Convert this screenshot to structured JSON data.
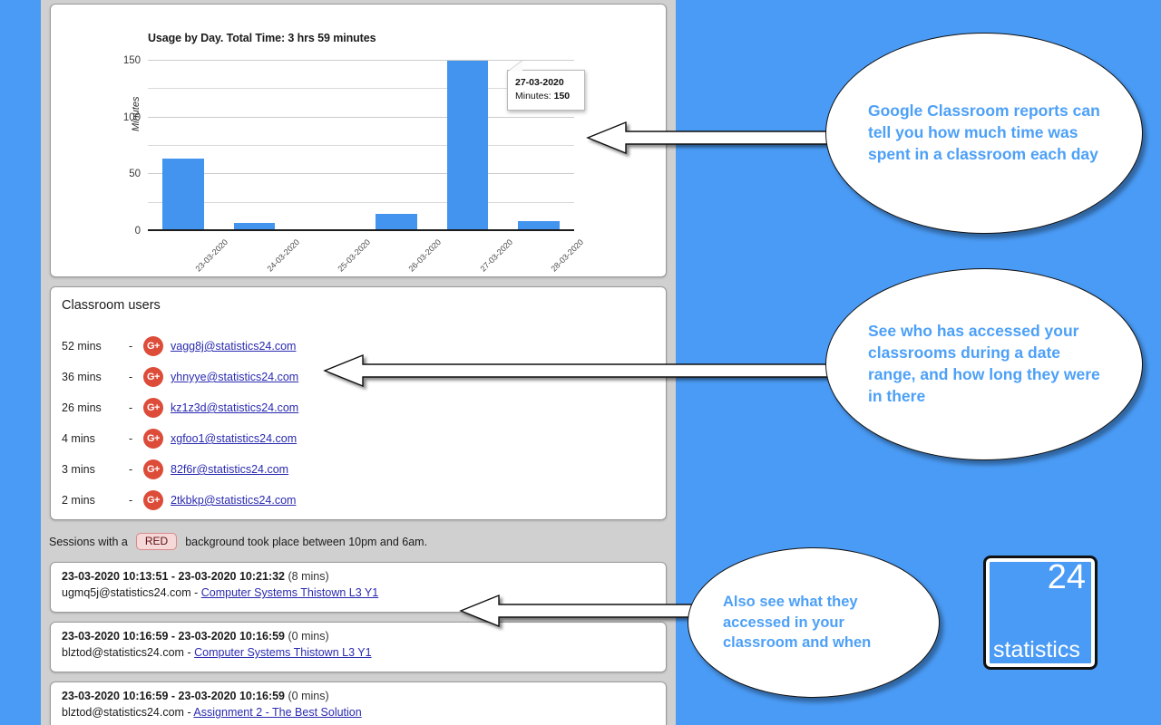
{
  "theme": {
    "background_blue": "#4a9bf5",
    "page_gray": "#d0d0d0",
    "bar_blue": "#4294ef",
    "link_blue": "#2a2ab0",
    "bubble_text_blue": "#4da0f7",
    "gplus_red": "#dd4b39"
  },
  "chart_data": {
    "type": "bar",
    "title": "Usage by Day. Total Time: 3 hrs 59 minutes",
    "xlabel": "",
    "ylabel": "Minutes",
    "categories": [
      "23-03-2020",
      "24-03-2020",
      "25-03-2020",
      "26-03-2020",
      "27-03-2020",
      "28-03-2020"
    ],
    "values": [
      64,
      7,
      1,
      15,
      150,
      9
    ],
    "ylim": [
      0,
      150
    ],
    "yticks": [
      0,
      50,
      100,
      150
    ],
    "ytick_labels": [
      "0",
      "50",
      "100",
      "150"
    ],
    "gridlines": [
      0,
      25,
      50,
      75,
      100,
      125,
      150
    ],
    "grid": true,
    "legend": "none",
    "tooltip": {
      "date": "27-03-2020",
      "label": "Minutes:",
      "value": "150",
      "attached_to_category": "27-03-2020"
    }
  },
  "users_panel": {
    "title": "Classroom users",
    "dash": "-",
    "icon": "google-plus-icon",
    "icon_label": "G+",
    "rows": [
      {
        "minutes": "52 mins",
        "email": "vagg8j@statistics24.com"
      },
      {
        "minutes": "36 mins",
        "email": "yhnyye@statistics24.com"
      },
      {
        "minutes": "26 mins",
        "email": "kz1z3d@statistics24.com"
      },
      {
        "minutes": "4 mins",
        "email": "xgfoo1@statistics24.com"
      },
      {
        "minutes": "3 mins",
        "email": "82f6r@statistics24.com"
      },
      {
        "minutes": "2 mins",
        "email": "2tkbkp@statistics24.com"
      }
    ]
  },
  "legend_note": {
    "prefix": "Sessions with a",
    "badge": "RED",
    "suffix": "background took place between 10pm and 6am."
  },
  "sessions": [
    {
      "range": "23-03-2020 10:13:51 - 23-03-2020 10:21:32",
      "duration": "(8 mins)",
      "email": "ugmq5j@statistics24.com",
      "separator": "-",
      "resource": "Computer Systems Thistown L3 Y1"
    },
    {
      "range": "23-03-2020 10:16:59 - 23-03-2020 10:16:59",
      "duration": "(0 mins)",
      "email": "blztod@statistics24.com",
      "separator": "-",
      "resource": "Computer Systems Thistown L3 Y1"
    },
    {
      "range": "23-03-2020 10:16:59 - 23-03-2020 10:16:59",
      "duration": "(0 mins)",
      "email": "blztod@statistics24.com",
      "separator": "-",
      "resource": "Assignment 2 - The Best Solution"
    }
  ],
  "callouts": [
    {
      "text": "Google Classroom reports can tell you how much time was spent in a classroom each day"
    },
    {
      "text": "See who has accessed your classrooms during a date range, and how long they were in there"
    },
    {
      "text": "Also see what they accessed in your classroom and when"
    }
  ],
  "logo": {
    "number": "24",
    "word": "statistics"
  }
}
